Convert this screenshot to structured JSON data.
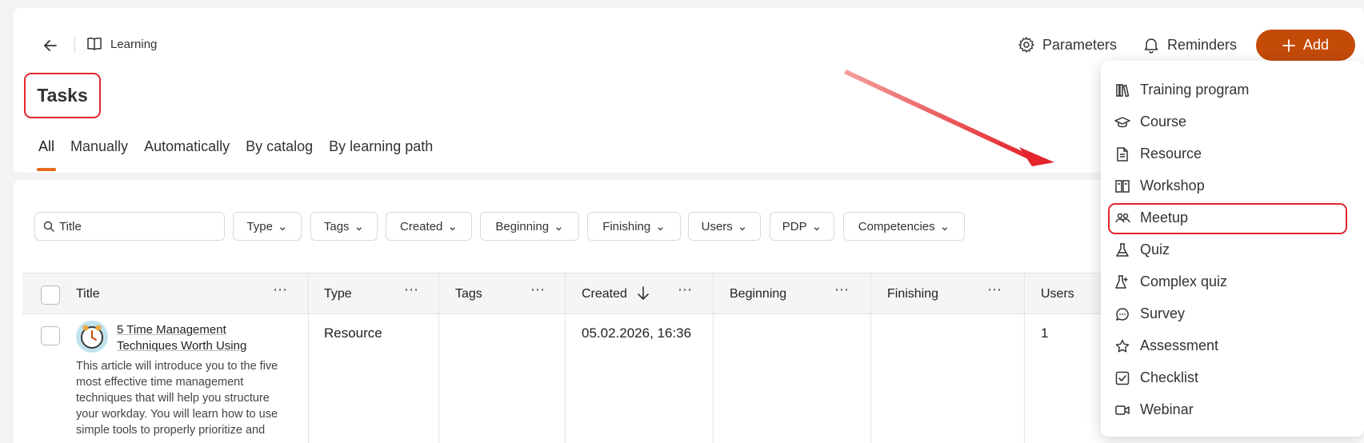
{
  "header": {
    "breadcrumb": "Learning",
    "parameters_label": "Parameters",
    "reminders_label": "Reminders",
    "add_label": "Add"
  },
  "page_title": "Tasks",
  "tabs": [
    {
      "label": "All",
      "active": true
    },
    {
      "label": "Manually"
    },
    {
      "label": "Automatically"
    },
    {
      "label": "By catalog"
    },
    {
      "label": "By learning path"
    }
  ],
  "filters": {
    "search_placeholder": "Title",
    "chips": [
      "Type",
      "Tags",
      "Created",
      "Beginning",
      "Finishing",
      "Users",
      "PDP",
      "Competencies"
    ]
  },
  "table": {
    "columns": [
      "Title",
      "Type",
      "Tags",
      "Created",
      "Beginning",
      "Finishing",
      "Users"
    ],
    "rows": [
      {
        "title": "5 Time Management Techniques Worth Using",
        "description": "This article will introduce you to the five most effective time management techniques that will help you structure your workday. You will learn how to use simple tools to properly prioritize and",
        "type": "Resource",
        "tags": "",
        "created": "05.02.2026, 16:36",
        "beginning": "",
        "finishing": "",
        "users": "1"
      }
    ]
  },
  "add_menu": {
    "items": [
      {
        "label": "Training program",
        "icon": "books-icon"
      },
      {
        "label": "Course",
        "icon": "graduation-cap-icon"
      },
      {
        "label": "Resource",
        "icon": "document-icon"
      },
      {
        "label": "Workshop",
        "icon": "workshop-icon"
      },
      {
        "label": "Meetup",
        "icon": "people-icon",
        "highlighted": true
      },
      {
        "label": "Quiz",
        "icon": "flask-icon"
      },
      {
        "label": "Complex quiz",
        "icon": "complex-flask-icon"
      },
      {
        "label": "Survey",
        "icon": "chat-bubble-icon"
      },
      {
        "label": "Assessment",
        "icon": "star-icon"
      },
      {
        "label": "Checklist",
        "icon": "checkbox-icon"
      },
      {
        "label": "Webinar",
        "icon": "video-icon"
      }
    ]
  },
  "colors": {
    "accent": "#c44a08",
    "highlight": "#e3252b",
    "tab_underline": "#e86a1c"
  }
}
